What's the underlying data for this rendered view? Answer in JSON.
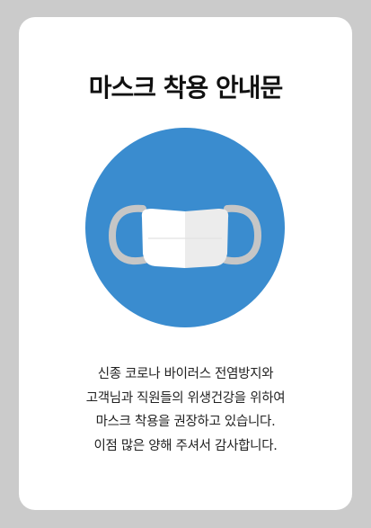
{
  "notice": {
    "title": "마스크 착용 안내문",
    "illustration_icon": "face-mask-icon",
    "message_lines": [
      "신종 코로나 바이러스 전염방지와",
      "고객님과 직원들의 위생건강을 위하여",
      "마스크 착용을 권장하고 있습니다.",
      "이점 많은 양해 주셔서 감사합니다."
    ]
  },
  "colors": {
    "background": "#cbcbcb",
    "card": "#ffffff",
    "circle": "#3a8ccf",
    "mask_light": "#ffffff",
    "mask_shade": "#ececec",
    "strap": "#c6c6c6",
    "text": "#222222"
  }
}
